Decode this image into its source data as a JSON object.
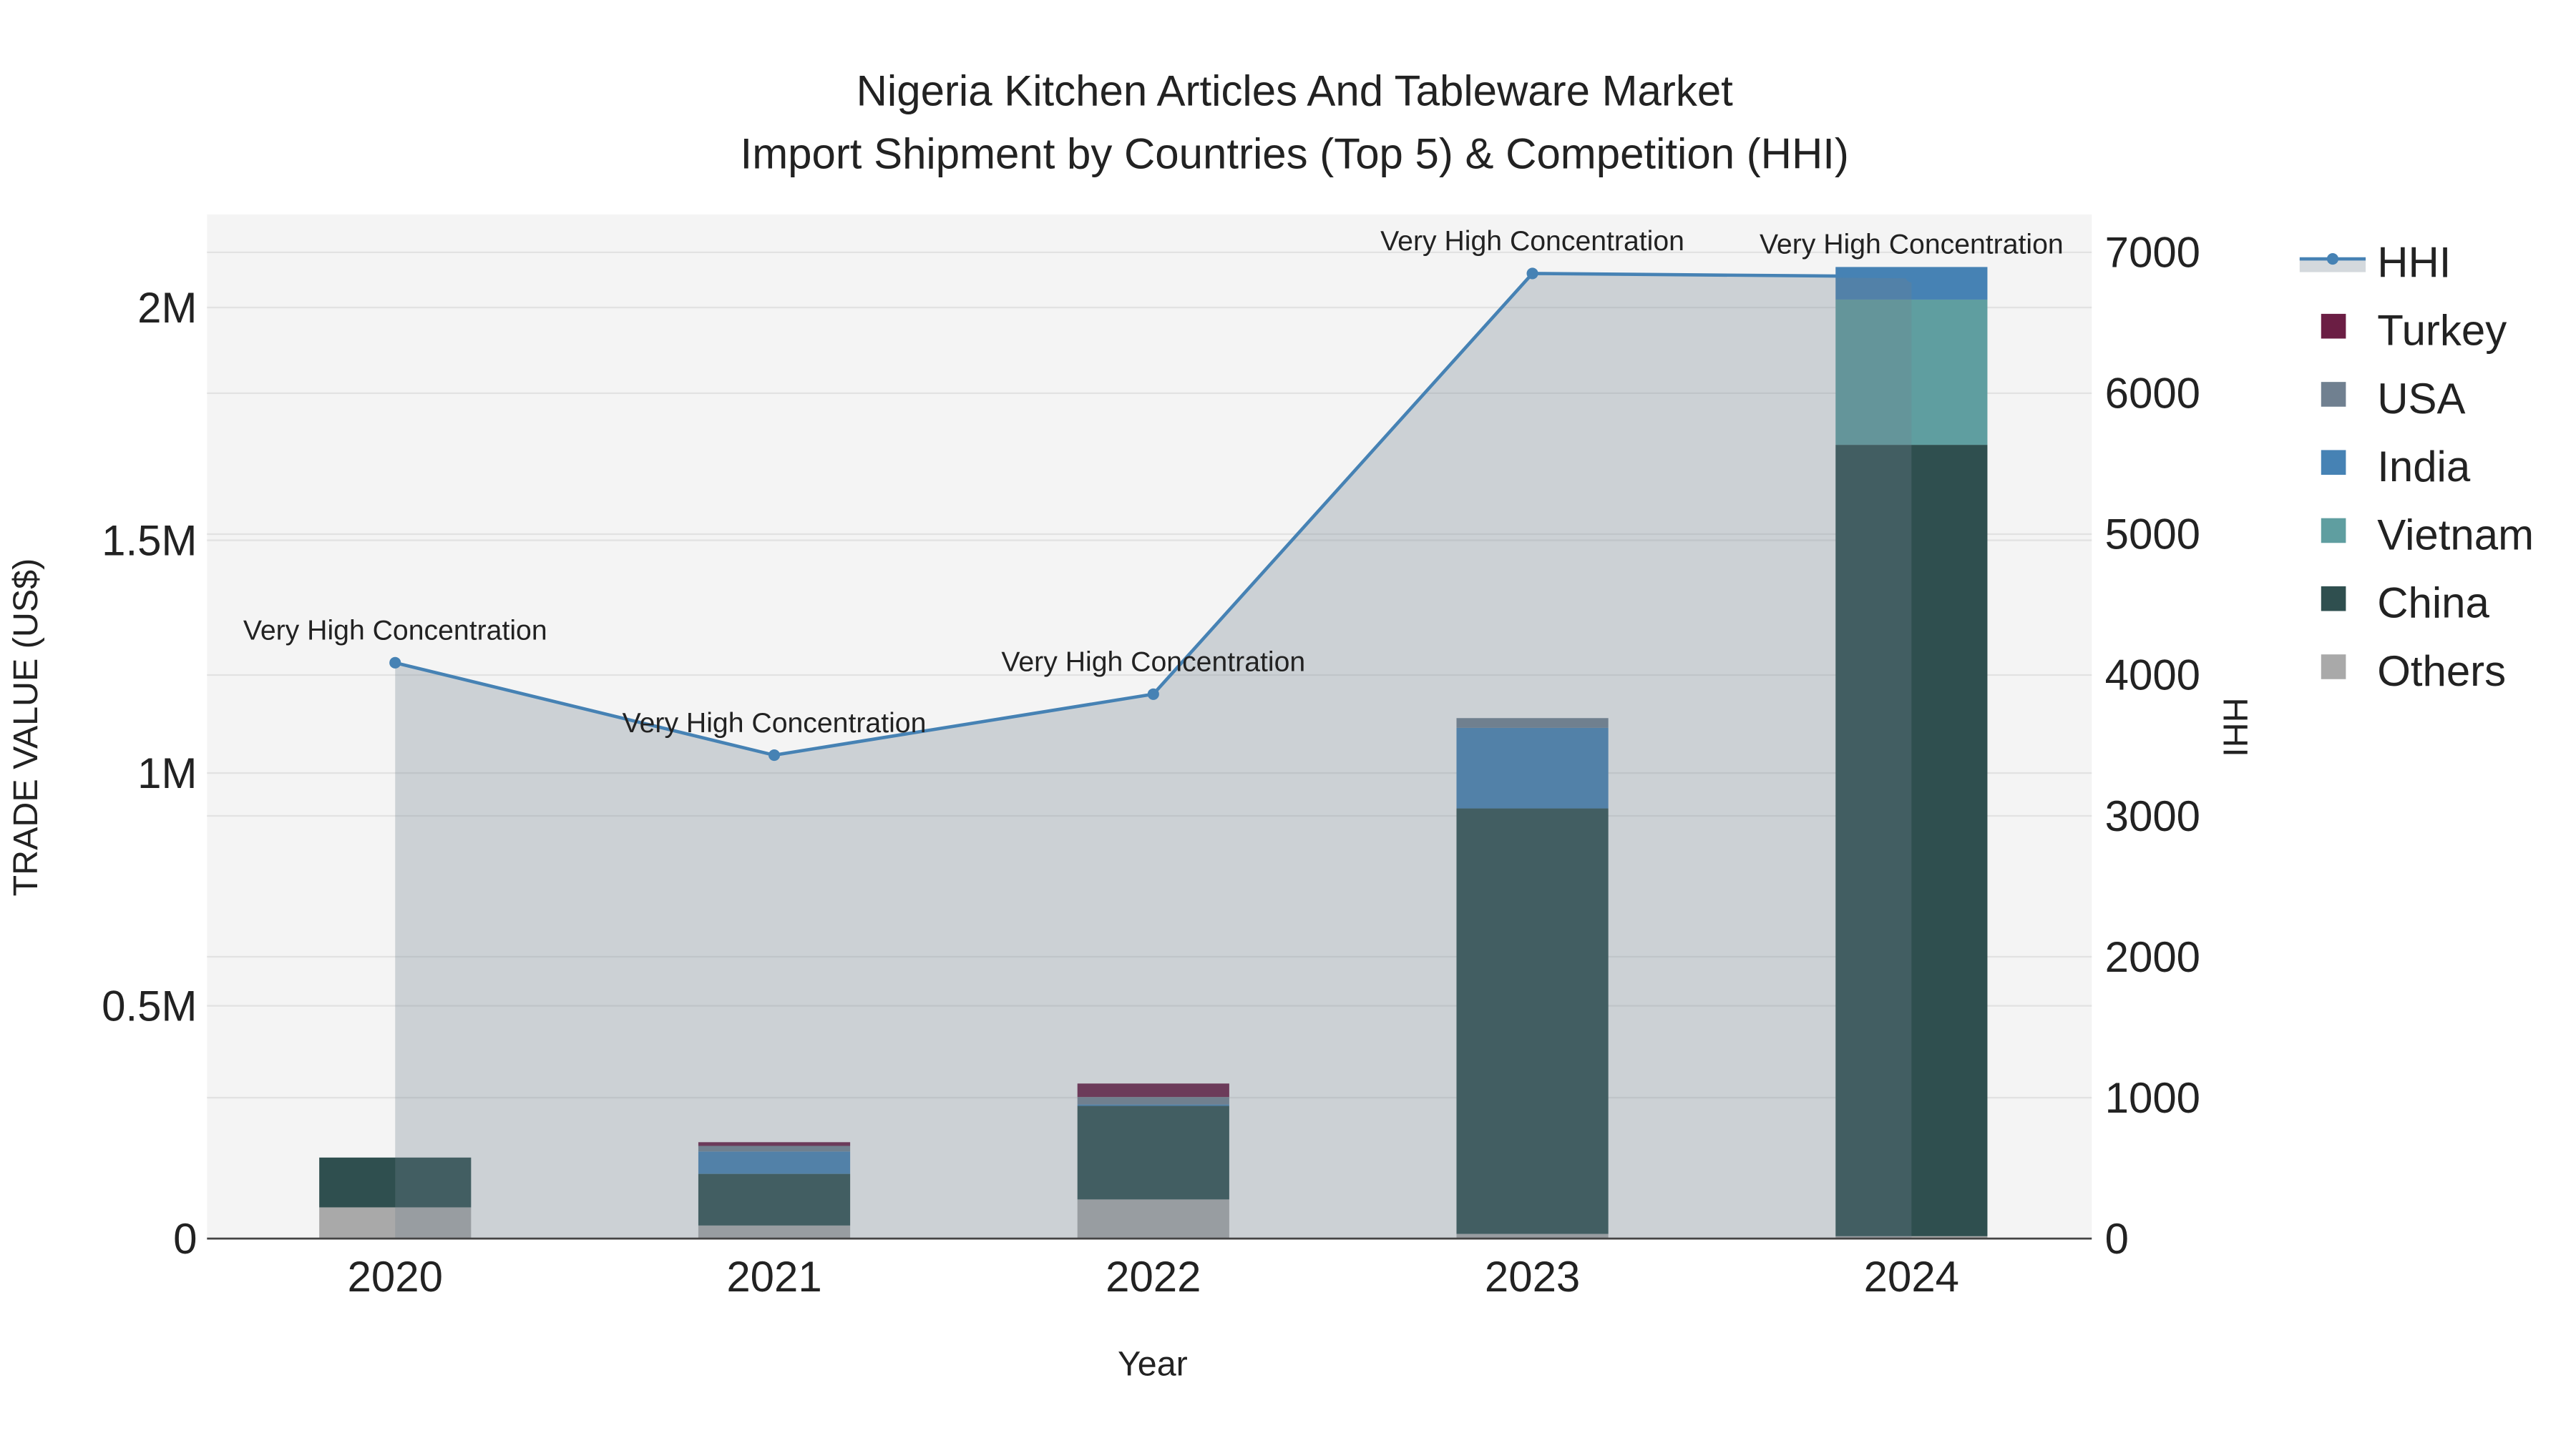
{
  "chart_data": {
    "type": "bar",
    "title_line1": "Nigeria Kitchen Articles And Tableware Market",
    "title_line2": "Import Shipment by Countries (Top 5) & Competition (HHI)",
    "xlabel": "Year",
    "ylabel": "TRADE VALUE (US$)",
    "y2label": "HHI",
    "categories": [
      "2020",
      "2021",
      "2022",
      "2023",
      "2024"
    ],
    "ylim": [
      0,
      2200000
    ],
    "y_ticks": [
      0,
      500000,
      1000000,
      1500000,
      2000000
    ],
    "y_tick_labels": [
      "0",
      "0.5M",
      "1M",
      "1.5M",
      "2M"
    ],
    "y2lim": [
      0,
      7250
    ],
    "y2_ticks": [
      0,
      1000,
      2000,
      3000,
      4000,
      5000,
      6000,
      7000
    ],
    "y2_tick_labels": [
      "0",
      "1000",
      "2000",
      "3000",
      "4000",
      "5000",
      "6000",
      "7000"
    ],
    "grid": true,
    "legend_placement": "right",
    "stacked_series": [
      {
        "name": "Others",
        "color": "#a9a9a9",
        "values": [
          67000,
          28000,
          84000,
          10000,
          5000
        ]
      },
      {
        "name": "China",
        "color": "#2f4f4f",
        "values": [
          107000,
          111000,
          201000,
          914000,
          1700000
        ]
      },
      {
        "name": "Vietnam",
        "color": "#5f9ea0",
        "values": [
          0,
          0,
          0,
          0,
          312000
        ]
      },
      {
        "name": "India",
        "color": "#4682b4",
        "values": [
          0,
          48000,
          3000,
          173000,
          70000
        ]
      },
      {
        "name": "USA",
        "color": "#708090",
        "values": [
          0,
          12000,
          16000,
          21000,
          0
        ]
      },
      {
        "name": "Turkey",
        "color": "#6b1e44",
        "values": [
          0,
          8000,
          29000,
          0,
          0
        ]
      }
    ],
    "hhi": {
      "name": "HHI",
      "color": "#4682b4",
      "values": [
        4087,
        3431,
        3864,
        6850,
        6827
      ],
      "annotations": [
        "Very High Concentration",
        "Very High Concentration",
        "Very High Concentration",
        "Very High Concentration",
        "Very High Concentration"
      ]
    },
    "legend_order": [
      "HHI",
      "Turkey",
      "USA",
      "India",
      "Vietnam",
      "China",
      "Others"
    ]
  }
}
